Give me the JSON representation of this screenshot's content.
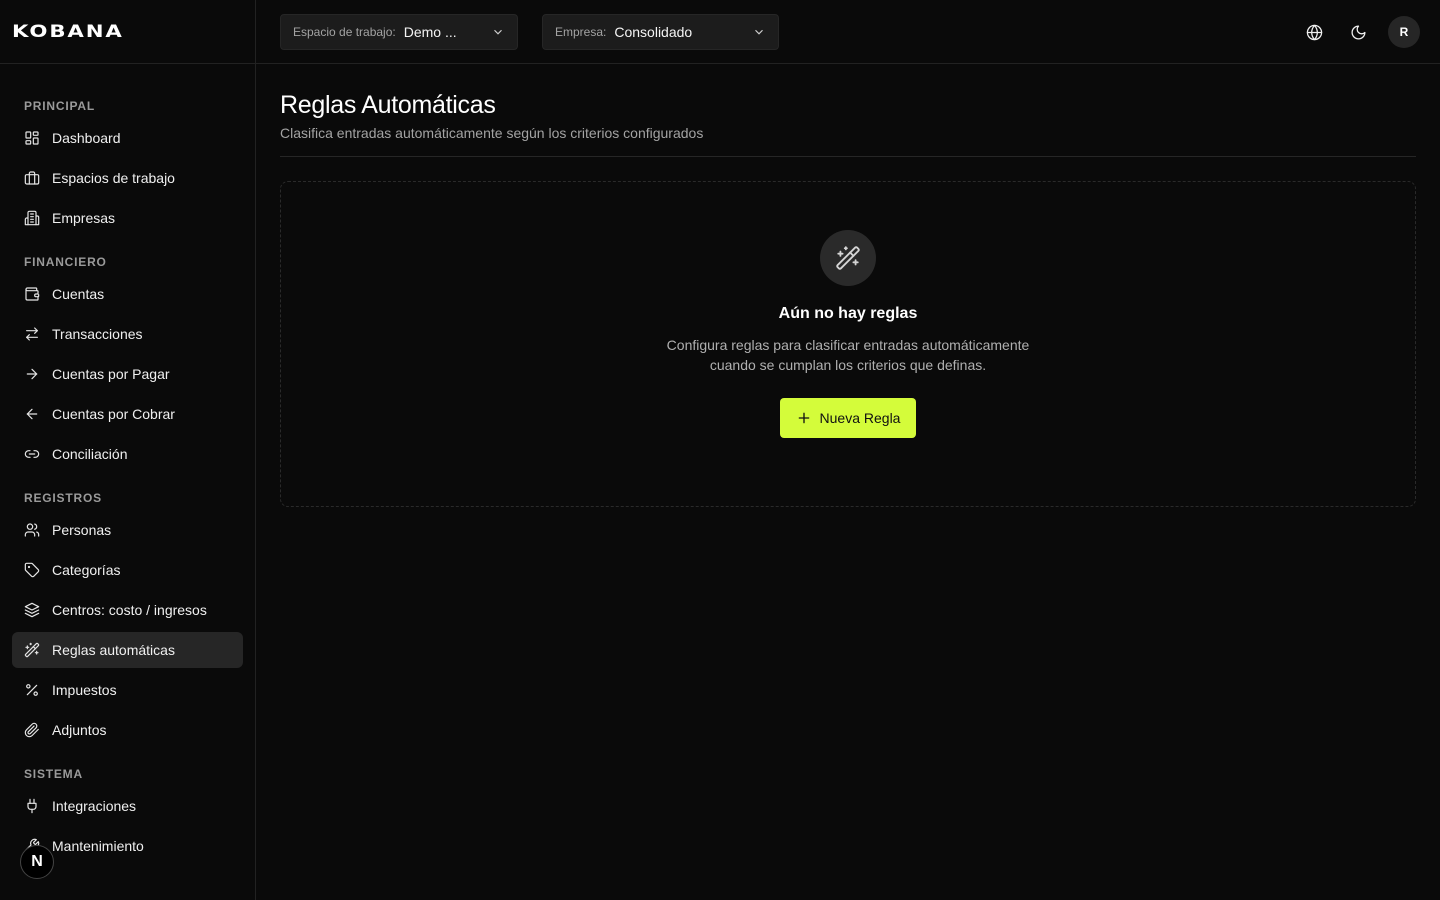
{
  "app": {
    "logo": "KOBANA"
  },
  "topbar": {
    "workspace_label": "Espacio de trabajo:",
    "workspace_value": "Demo ...",
    "company_label": "Empresa:",
    "company_value": "Consolidado",
    "avatar_initial": "R"
  },
  "sidebar": {
    "sections": [
      {
        "label": "PRINCIPAL",
        "items": [
          {
            "label": "Dashboard",
            "icon": "dashboard-icon"
          },
          {
            "label": "Espacios de trabajo",
            "icon": "briefcase-icon"
          },
          {
            "label": "Empresas",
            "icon": "building-icon"
          }
        ]
      },
      {
        "label": "FINANCIERO",
        "items": [
          {
            "label": "Cuentas",
            "icon": "wallet-icon"
          },
          {
            "label": "Transacciones",
            "icon": "arrows-exchange-icon"
          },
          {
            "label": "Cuentas por Pagar",
            "icon": "arrow-right-icon"
          },
          {
            "label": "Cuentas por Cobrar",
            "icon": "arrow-left-icon"
          },
          {
            "label": "Conciliación",
            "icon": "link-icon"
          }
        ]
      },
      {
        "label": "REGISTROS",
        "items": [
          {
            "label": "Personas",
            "icon": "users-icon"
          },
          {
            "label": "Categorías",
            "icon": "tag-icon"
          },
          {
            "label": "Centros: costo / ingresos",
            "icon": "layers-icon"
          },
          {
            "label": "Reglas automáticas",
            "icon": "magic-wand-icon",
            "active": true
          },
          {
            "label": "Impuestos",
            "icon": "percent-icon"
          },
          {
            "label": "Adjuntos",
            "icon": "paperclip-icon"
          }
        ]
      },
      {
        "label": "SISTEMA",
        "items": [
          {
            "label": "Integraciones",
            "icon": "plug-icon"
          },
          {
            "label": "Mantenimiento",
            "icon": "wrench-icon"
          }
        ]
      }
    ],
    "next_badge": "N"
  },
  "main": {
    "title": "Reglas Automáticas",
    "subtitle": "Clasifica entradas automáticamente según los criterios configurados",
    "empty_state": {
      "icon": "magic-wand-icon",
      "title": "Aún no hay reglas",
      "description": "Configura reglas para clasificar entradas automáticamente cuando se cumplan los criterios que definas.",
      "button_label": "Nueva Regla"
    }
  },
  "colors": {
    "background": "#0a0a0a",
    "accent": "#d4fc3a",
    "active_item": "#262626"
  }
}
